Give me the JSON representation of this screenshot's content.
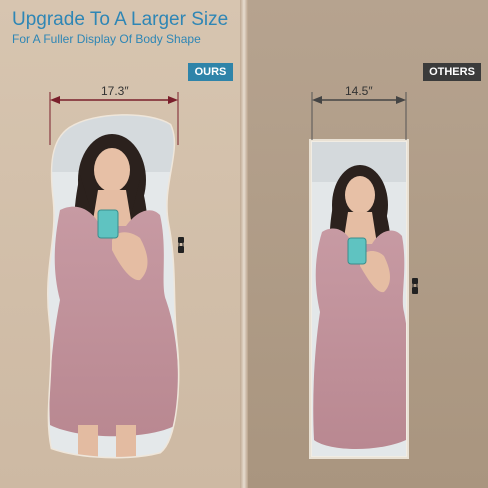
{
  "header": {
    "title": "Upgrade To A Larger Size",
    "subtitle": "For A Fuller Display Of Body Shape"
  },
  "ours": {
    "badge": "OURS",
    "width_label": "17.3″"
  },
  "others": {
    "badge": "OTHERS",
    "width_label": "14.5″"
  },
  "colors": {
    "accent": "#2e86b5",
    "ours_badge": "#2f84a9",
    "others_badge": "#3b3b3b",
    "measure_line": "#7a1f2b"
  }
}
